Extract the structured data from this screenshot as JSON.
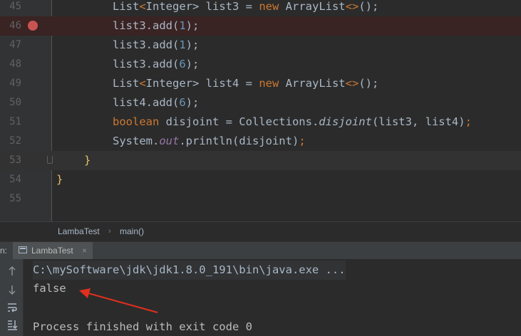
{
  "editor": {
    "lines": [
      {
        "num": "45",
        "tokens": [
          {
            "t": "List",
            "c": ""
          },
          {
            "t": "<",
            "c": "kw"
          },
          {
            "t": "Integer",
            "c": ""
          },
          {
            "t": "> list3 = ",
            "c": ""
          },
          {
            "t": "new ",
            "c": "kw"
          },
          {
            "t": "ArrayList",
            "c": ""
          },
          {
            "t": "<>",
            "c": "kw"
          },
          {
            "t": "();",
            "c": ""
          }
        ]
      },
      {
        "num": "46",
        "breakpoint": true,
        "tokens": [
          {
            "t": "list3.add(",
            "c": ""
          },
          {
            "t": "1",
            "c": "num"
          },
          {
            "t": ");",
            "c": ""
          }
        ]
      },
      {
        "num": "47",
        "tokens": [
          {
            "t": "list3.add(",
            "c": ""
          },
          {
            "t": "1",
            "c": "num"
          },
          {
            "t": ");",
            "c": ""
          }
        ]
      },
      {
        "num": "48",
        "tokens": [
          {
            "t": "list3.add(",
            "c": ""
          },
          {
            "t": "6",
            "c": "num"
          },
          {
            "t": ");",
            "c": ""
          }
        ]
      },
      {
        "num": "49",
        "tokens": [
          {
            "t": "List",
            "c": ""
          },
          {
            "t": "<",
            "c": "kw"
          },
          {
            "t": "Integer",
            "c": ""
          },
          {
            "t": "> list4 = ",
            "c": ""
          },
          {
            "t": "new ",
            "c": "kw"
          },
          {
            "t": "ArrayList",
            "c": ""
          },
          {
            "t": "<>",
            "c": "kw"
          },
          {
            "t": "();",
            "c": ""
          }
        ]
      },
      {
        "num": "50",
        "tokens": [
          {
            "t": "list4.add(",
            "c": ""
          },
          {
            "t": "6",
            "c": "num"
          },
          {
            "t": ");",
            "c": ""
          }
        ]
      },
      {
        "num": "51",
        "tokens": [
          {
            "t": "boolean ",
            "c": "kw"
          },
          {
            "t": "disjoint = Collections.",
            "c": ""
          },
          {
            "t": "disjoint",
            "c": "it"
          },
          {
            "t": "(list3, list4)",
            "c": ""
          },
          {
            "t": ";",
            "c": "kw"
          }
        ]
      },
      {
        "num": "52",
        "tokens": [
          {
            "t": "System.",
            "c": ""
          },
          {
            "t": "out",
            "c": "fld"
          },
          {
            "t": ".println(disjoint)",
            "c": ""
          },
          {
            "t": ";",
            "c": "kw"
          }
        ]
      },
      {
        "num": "53",
        "current": true,
        "fold": true,
        "tokens": [
          {
            "t": "}",
            "c": "brace"
          }
        ]
      },
      {
        "num": "54",
        "tokens": [
          {
            "t": "}",
            "c": "brace"
          }
        ]
      },
      {
        "num": "55",
        "tokens": []
      }
    ]
  },
  "breadcrumb": {
    "class_name": "LambaTest",
    "method_name": "main()"
  },
  "run": {
    "prefix": "n:",
    "tab_label": "LambaTest",
    "tab_close": "×",
    "toolbar_icons": [
      "arrow-up-icon",
      "arrow-down-icon",
      "soft-wrap-icon",
      "scroll-to-end-icon"
    ],
    "console_lines": [
      "C:\\mySoftware\\jdk\\jdk1.8.0_191\\bin\\java.exe ...",
      "false",
      "",
      "Process finished with exit code 0"
    ]
  },
  "colors": {
    "editor_bg": "#2b2b2b",
    "keyword": "#cc7832",
    "number": "#6897bb",
    "field": "#9876aa",
    "breakpoint": "#c75450",
    "annotation_arrow": "#e0301e"
  }
}
